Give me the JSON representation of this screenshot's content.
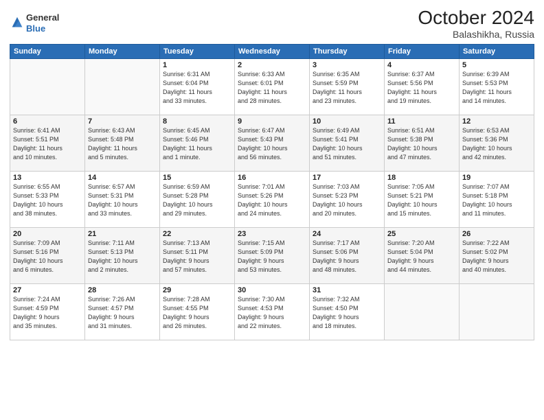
{
  "header": {
    "logo_general": "General",
    "logo_blue": "Blue",
    "month": "October 2024",
    "location": "Balashikha, Russia"
  },
  "weekdays": [
    "Sunday",
    "Monday",
    "Tuesday",
    "Wednesday",
    "Thursday",
    "Friday",
    "Saturday"
  ],
  "weeks": [
    [
      {
        "day": "",
        "info": ""
      },
      {
        "day": "",
        "info": ""
      },
      {
        "day": "1",
        "info": "Sunrise: 6:31 AM\nSunset: 6:04 PM\nDaylight: 11 hours\nand 33 minutes."
      },
      {
        "day": "2",
        "info": "Sunrise: 6:33 AM\nSunset: 6:01 PM\nDaylight: 11 hours\nand 28 minutes."
      },
      {
        "day": "3",
        "info": "Sunrise: 6:35 AM\nSunset: 5:59 PM\nDaylight: 11 hours\nand 23 minutes."
      },
      {
        "day": "4",
        "info": "Sunrise: 6:37 AM\nSunset: 5:56 PM\nDaylight: 11 hours\nand 19 minutes."
      },
      {
        "day": "5",
        "info": "Sunrise: 6:39 AM\nSunset: 5:53 PM\nDaylight: 11 hours\nand 14 minutes."
      }
    ],
    [
      {
        "day": "6",
        "info": "Sunrise: 6:41 AM\nSunset: 5:51 PM\nDaylight: 11 hours\nand 10 minutes."
      },
      {
        "day": "7",
        "info": "Sunrise: 6:43 AM\nSunset: 5:48 PM\nDaylight: 11 hours\nand 5 minutes."
      },
      {
        "day": "8",
        "info": "Sunrise: 6:45 AM\nSunset: 5:46 PM\nDaylight: 11 hours\nand 1 minute."
      },
      {
        "day": "9",
        "info": "Sunrise: 6:47 AM\nSunset: 5:43 PM\nDaylight: 10 hours\nand 56 minutes."
      },
      {
        "day": "10",
        "info": "Sunrise: 6:49 AM\nSunset: 5:41 PM\nDaylight: 10 hours\nand 51 minutes."
      },
      {
        "day": "11",
        "info": "Sunrise: 6:51 AM\nSunset: 5:38 PM\nDaylight: 10 hours\nand 47 minutes."
      },
      {
        "day": "12",
        "info": "Sunrise: 6:53 AM\nSunset: 5:36 PM\nDaylight: 10 hours\nand 42 minutes."
      }
    ],
    [
      {
        "day": "13",
        "info": "Sunrise: 6:55 AM\nSunset: 5:33 PM\nDaylight: 10 hours\nand 38 minutes."
      },
      {
        "day": "14",
        "info": "Sunrise: 6:57 AM\nSunset: 5:31 PM\nDaylight: 10 hours\nand 33 minutes."
      },
      {
        "day": "15",
        "info": "Sunrise: 6:59 AM\nSunset: 5:28 PM\nDaylight: 10 hours\nand 29 minutes."
      },
      {
        "day": "16",
        "info": "Sunrise: 7:01 AM\nSunset: 5:26 PM\nDaylight: 10 hours\nand 24 minutes."
      },
      {
        "day": "17",
        "info": "Sunrise: 7:03 AM\nSunset: 5:23 PM\nDaylight: 10 hours\nand 20 minutes."
      },
      {
        "day": "18",
        "info": "Sunrise: 7:05 AM\nSunset: 5:21 PM\nDaylight: 10 hours\nand 15 minutes."
      },
      {
        "day": "19",
        "info": "Sunrise: 7:07 AM\nSunset: 5:18 PM\nDaylight: 10 hours\nand 11 minutes."
      }
    ],
    [
      {
        "day": "20",
        "info": "Sunrise: 7:09 AM\nSunset: 5:16 PM\nDaylight: 10 hours\nand 6 minutes."
      },
      {
        "day": "21",
        "info": "Sunrise: 7:11 AM\nSunset: 5:13 PM\nDaylight: 10 hours\nand 2 minutes."
      },
      {
        "day": "22",
        "info": "Sunrise: 7:13 AM\nSunset: 5:11 PM\nDaylight: 9 hours\nand 57 minutes."
      },
      {
        "day": "23",
        "info": "Sunrise: 7:15 AM\nSunset: 5:09 PM\nDaylight: 9 hours\nand 53 minutes."
      },
      {
        "day": "24",
        "info": "Sunrise: 7:17 AM\nSunset: 5:06 PM\nDaylight: 9 hours\nand 48 minutes."
      },
      {
        "day": "25",
        "info": "Sunrise: 7:20 AM\nSunset: 5:04 PM\nDaylight: 9 hours\nand 44 minutes."
      },
      {
        "day": "26",
        "info": "Sunrise: 7:22 AM\nSunset: 5:02 PM\nDaylight: 9 hours\nand 40 minutes."
      }
    ],
    [
      {
        "day": "27",
        "info": "Sunrise: 7:24 AM\nSunset: 4:59 PM\nDaylight: 9 hours\nand 35 minutes."
      },
      {
        "day": "28",
        "info": "Sunrise: 7:26 AM\nSunset: 4:57 PM\nDaylight: 9 hours\nand 31 minutes."
      },
      {
        "day": "29",
        "info": "Sunrise: 7:28 AM\nSunset: 4:55 PM\nDaylight: 9 hours\nand 26 minutes."
      },
      {
        "day": "30",
        "info": "Sunrise: 7:30 AM\nSunset: 4:53 PM\nDaylight: 9 hours\nand 22 minutes."
      },
      {
        "day": "31",
        "info": "Sunrise: 7:32 AM\nSunset: 4:50 PM\nDaylight: 9 hours\nand 18 minutes."
      },
      {
        "day": "",
        "info": ""
      },
      {
        "day": "",
        "info": ""
      }
    ]
  ]
}
